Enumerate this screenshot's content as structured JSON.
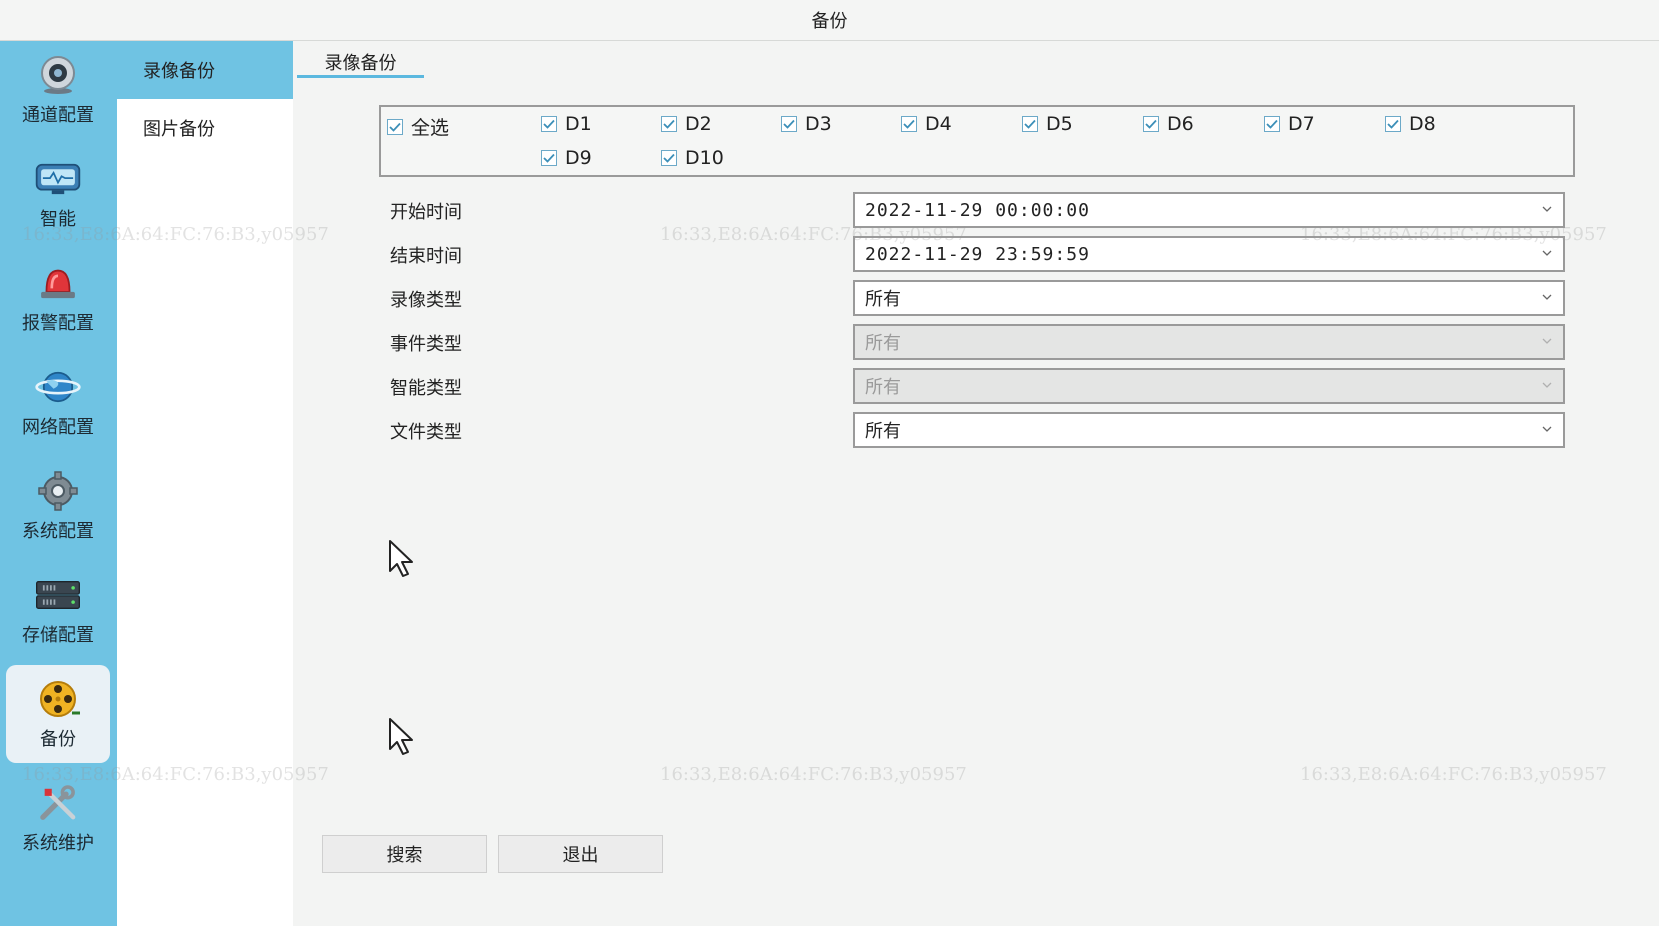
{
  "window": {
    "title": "备份"
  },
  "rail": {
    "items": [
      {
        "label": "通道配置",
        "icon": "camera-icon"
      },
      {
        "label": "智能",
        "icon": "monitor-icon"
      },
      {
        "label": "报警配置",
        "icon": "alarm-siren-icon"
      },
      {
        "label": "网络配置",
        "icon": "globe-icon"
      },
      {
        "label": "系统配置",
        "icon": "gear-icon"
      },
      {
        "label": "存储配置",
        "icon": "hard-drive-icon"
      },
      {
        "label": "备份",
        "icon": "film-reel-icon"
      },
      {
        "label": "系统维护",
        "icon": "tools-icon"
      }
    ],
    "active": "备份"
  },
  "subnav": {
    "items": [
      {
        "label": "录像备份"
      },
      {
        "label": "图片备份"
      }
    ],
    "active": "录像备份"
  },
  "tab": {
    "label": "录像备份"
  },
  "channels": {
    "select_all": {
      "label": "全选",
      "checked": true
    },
    "items": [
      {
        "label": "D1",
        "checked": true
      },
      {
        "label": "D2",
        "checked": true
      },
      {
        "label": "D3",
        "checked": true
      },
      {
        "label": "D4",
        "checked": true
      },
      {
        "label": "D5",
        "checked": true
      },
      {
        "label": "D6",
        "checked": true
      },
      {
        "label": "D7",
        "checked": true
      },
      {
        "label": "D8",
        "checked": true
      },
      {
        "label": "D9",
        "checked": true
      },
      {
        "label": "D10",
        "checked": true
      }
    ]
  },
  "form": {
    "start_time": {
      "label": "开始时间",
      "value": "2022-11-29 00:00:00"
    },
    "end_time": {
      "label": "结束时间",
      "value": "2022-11-29 23:59:59"
    },
    "record_type": {
      "label": "录像类型",
      "value": "所有"
    },
    "event_type": {
      "label": "事件类型",
      "value": "所有",
      "disabled": true
    },
    "smart_type": {
      "label": "智能类型",
      "value": "所有",
      "disabled": true
    },
    "file_type": {
      "label": "文件类型",
      "value": "所有"
    }
  },
  "buttons": {
    "search": "搜索",
    "exit": "退出"
  },
  "watermark": {
    "text": "16:33,E8:6A:64:FC:76:B3,y05957"
  },
  "colors": {
    "accent": "#6fc3e3",
    "tab_underline": "#5bb8df",
    "panel_bg": "#f3f4f3"
  }
}
